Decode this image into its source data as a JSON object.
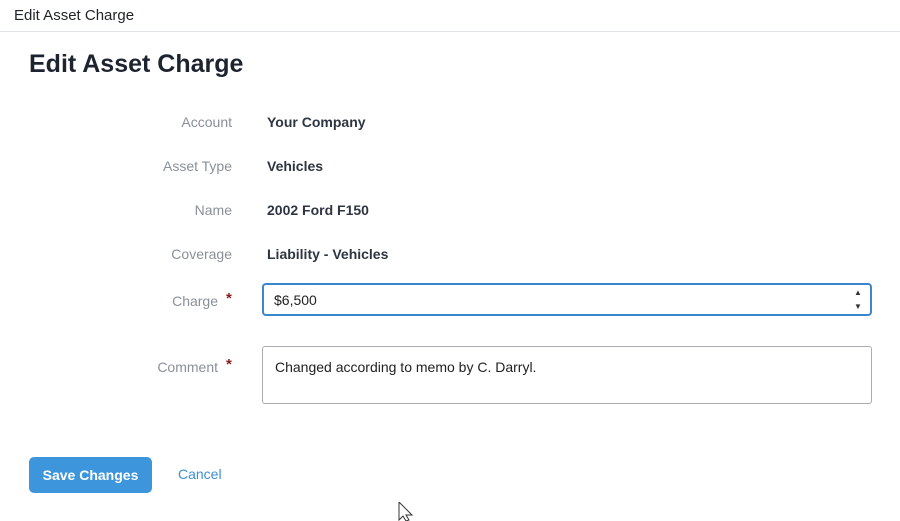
{
  "window": {
    "title": "Edit Asset Charge"
  },
  "page": {
    "title": "Edit Asset Charge"
  },
  "fields": {
    "account": {
      "label": "Account",
      "value": "Your Company"
    },
    "asset_type": {
      "label": "Asset Type",
      "value": "Vehicles"
    },
    "name": {
      "label": "Name",
      "value": "2002 Ford F150"
    },
    "coverage": {
      "label": "Coverage",
      "value": "Liability - Vehicles"
    },
    "charge": {
      "label": "Charge",
      "required_marker": "*",
      "value": "$6,500"
    },
    "comment": {
      "label": "Comment",
      "required_marker": "*",
      "value": "Changed according to memo by C. Darryl."
    }
  },
  "actions": {
    "save_label": "Save Changes",
    "cancel_label": "Cancel"
  },
  "icons": {
    "stepper_up": "chevron-up-icon",
    "stepper_down": "chevron-down-icon",
    "cursor": "mouse-pointer-icon"
  },
  "colors": {
    "accent": "#3d96dc",
    "focus_border": "#3b86d0",
    "required": "#8b1a1a",
    "link": "#3d8fd1"
  }
}
